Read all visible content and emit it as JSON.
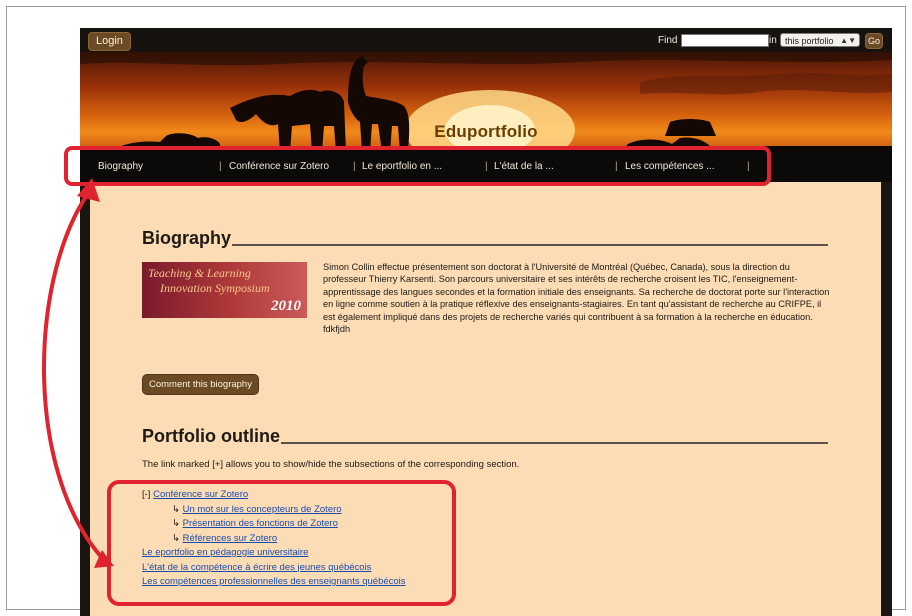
{
  "header": {
    "login_label": "Login",
    "find_label": "Find",
    "find_value": "",
    "in_label": "in",
    "scope_value": "this portfolio",
    "go_label": "Go",
    "site_title": "Eduportfolio"
  },
  "nav": {
    "items": [
      {
        "label": "Biography"
      },
      {
        "label": "Conférence sur Zotero"
      },
      {
        "label": "Le eportfolio en ..."
      },
      {
        "label": "L'état de la ..."
      },
      {
        "label": "Les compétences ..."
      }
    ],
    "separator": "|"
  },
  "biography": {
    "heading": "Biography",
    "image_text": [
      "Teaching & Learning",
      "Innovation Symposium",
      "2010"
    ],
    "text": "Simon Collin effectue présentement son doctorat à l'Université de Montréal (Québec, Canada), sous la direction du professeur Thierry Karsenti. Son parcours universitaire et ses intérêts de recherche croisent les TIC, l'enseignement-apprentissage des langues secondes et la formation initiale des enseignants. Sa recherche de doctorat porte sur l'interaction en ligne comme soutien à la pratique réflexive des enseignants-stagiaires. En tant qu'assistant de recherche au CRIFPE, il est également impliqué dans des projets de recherche variés qui contribuent à sa formation à la recherche en éducation. fdkfjdh",
    "comment_button": "Comment this biography"
  },
  "outline": {
    "heading": "Portfolio outline",
    "intro": "The link marked [+] allows you to show/hide the subsections of the corresponding section.",
    "toggle": "[-]",
    "sub_arrow": "↳",
    "items": [
      {
        "label": "Conférence sur Zotero"
      },
      {
        "label": "Un mot sur les concepteurs de Zotero"
      },
      {
        "label": "Présentation des fonctions de Zotero"
      },
      {
        "label": "Références sur Zotero"
      },
      {
        "label": "Le eportfolio en pédagogie universitaire"
      },
      {
        "label": "L'état de la compétence à écrire des jeunes québécois"
      },
      {
        "label": "Les compétences professionnelles des enseignants québécois"
      }
    ]
  },
  "colors": {
    "annotation_red": "#e0232e",
    "content_bg": "#fcdcb4",
    "button_brown": "#6b4a26",
    "link_blue": "#1a4db0"
  }
}
